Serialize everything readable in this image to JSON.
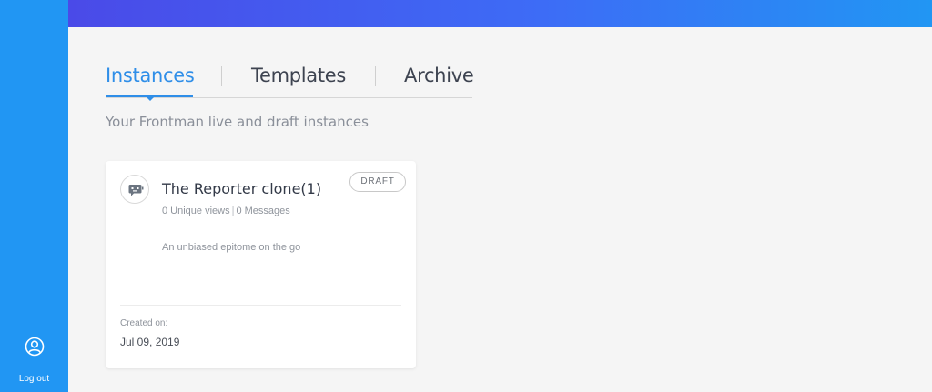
{
  "sidebar": {
    "logout_label": "Log out",
    "user_icon": "user-circle-icon"
  },
  "tabs": [
    {
      "label": "Instances",
      "active": true
    },
    {
      "label": "Templates",
      "active": false
    },
    {
      "label": "Archive",
      "active": false
    }
  ],
  "subtitle": "Your Frontman live and draft instances",
  "instances": [
    {
      "title": "The Reporter clone(1)",
      "unique_views": "0 Unique views",
      "messages": "0 Messages",
      "status": "DRAFT",
      "description": "An unbiased epitome on the go",
      "created_label": "Created on:",
      "created_date": "Jul 09, 2019",
      "icon": "chat-bot-icon"
    }
  ],
  "colors": {
    "sidebar": "#2196f3",
    "accent": "#2f8ee8",
    "topbar_start": "#4a4ae8",
    "topbar_end": "#2196f3"
  }
}
